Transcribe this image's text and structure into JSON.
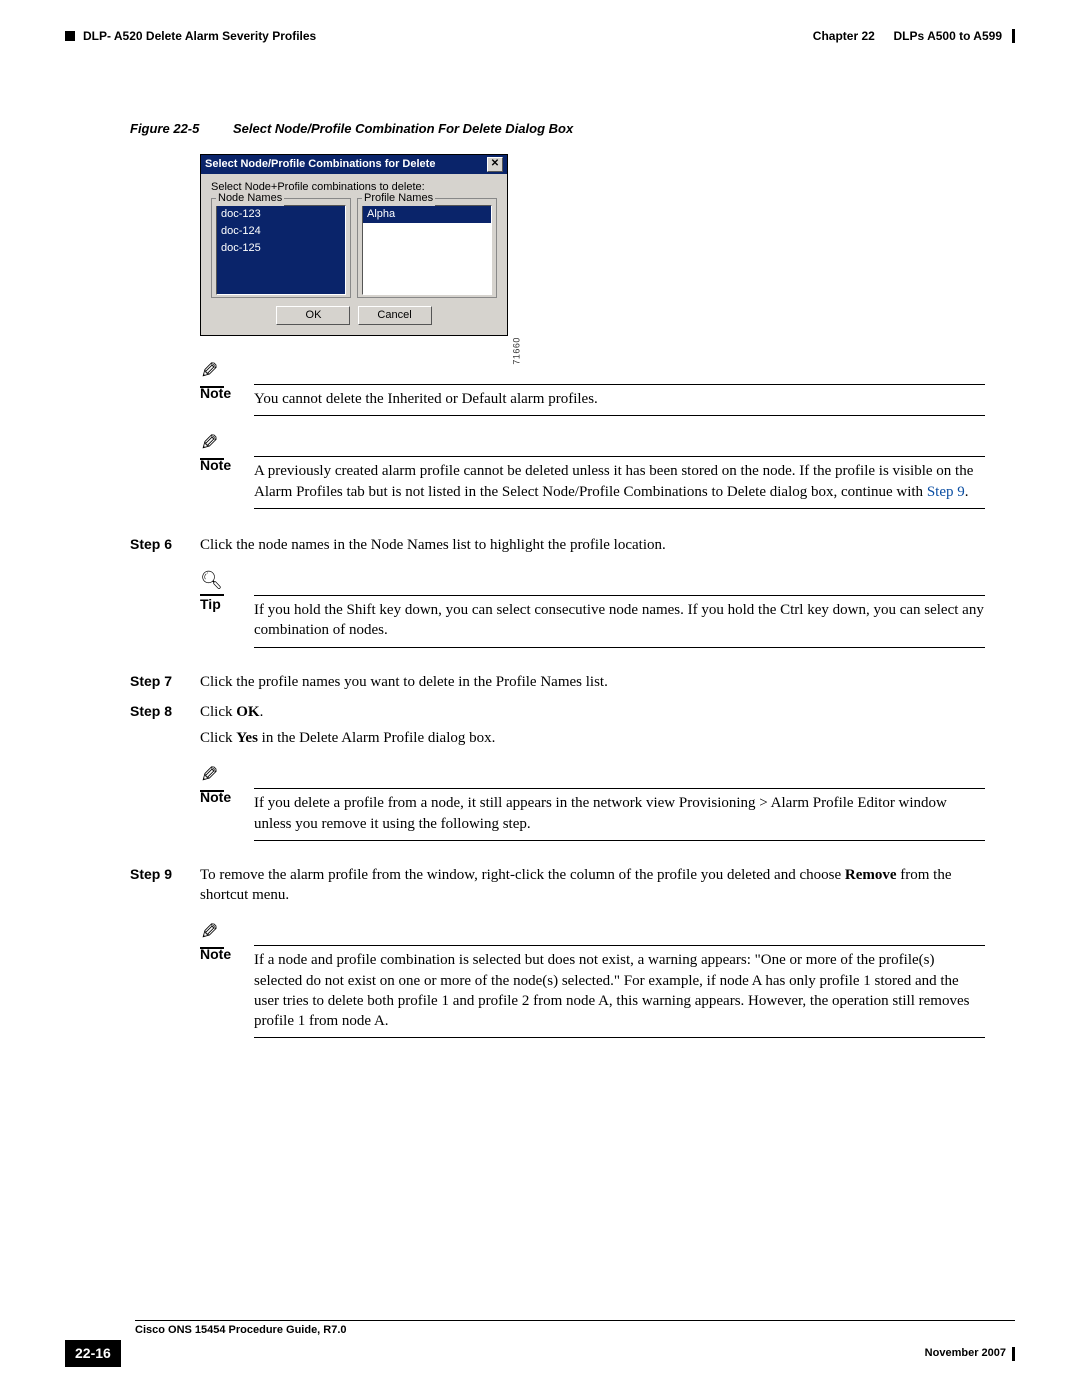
{
  "header": {
    "left": "DLP- A520 Delete Alarm Severity Profiles",
    "chapter": "Chapter 22",
    "right": "DLPs A500 to A599"
  },
  "figure": {
    "label": "Figure 22-5",
    "title": "Select Node/Profile Combination For Delete Dialog Box",
    "image_id": "71660"
  },
  "dialog": {
    "title": "Select Node/Profile Combinations for Delete",
    "close": "✕",
    "prompt": "Select Node+Profile combinations to delete:",
    "node_label": "Node Names",
    "profile_label": "Profile Names",
    "nodes": [
      "doc-123",
      "doc-124",
      "doc-125"
    ],
    "profiles": [
      "Alpha"
    ],
    "ok": "OK",
    "cancel": "Cancel"
  },
  "notes": {
    "note_label": "Note",
    "tip_label": "Tip",
    "n1": "You cannot delete the Inherited or Default alarm profiles.",
    "n2a": "A previously created alarm profile cannot be deleted unless it has been stored on the node. If the profile is visible on the Alarm Profiles tab but is not listed in the Select Node/Profile Combinations to Delete dialog box, continue with ",
    "n2link": "Step 9",
    "n2b": ".",
    "tip1": "If you hold the Shift key down, you can select consecutive node names. If you hold the Ctrl key down, you can select any combination of nodes.",
    "n3": "If you delete a profile from a node, it still appears in the network view Provisioning > Alarm Profile Editor window unless you remove it using the following step.",
    "n4": "If a node and profile combination is selected but does not exist, a warning appears: \"One or more of the profile(s) selected do not exist on one or more of the node(s) selected.\" For example, if node A has only profile 1 stored and the user tries to delete both profile 1 and profile 2 from node A, this warning appears. However, the operation still removes profile 1 from node A."
  },
  "steps": {
    "s6_label": "Step 6",
    "s6": "Click the node names in the Node Names list to highlight the profile location.",
    "s7_label": "Step 7",
    "s7": "Click the profile names you want to delete in the Profile Names list.",
    "s8_label": "Step 8",
    "s8a": "Click ",
    "s8b": "OK",
    "s8c": ".",
    "s8_2a": "Click ",
    "s8_2b": "Yes",
    "s8_2c": " in the Delete Alarm Profile dialog box.",
    "s9_label": "Step 9",
    "s9a": "To remove the alarm profile from the window, right-click the column of the profile you deleted and choose ",
    "s9b": "Remove",
    "s9c": " from the shortcut menu."
  },
  "footer": {
    "guide": "Cisco ONS 15454 Procedure Guide, R7.0",
    "page": "22-16",
    "date": "November 2007"
  }
}
